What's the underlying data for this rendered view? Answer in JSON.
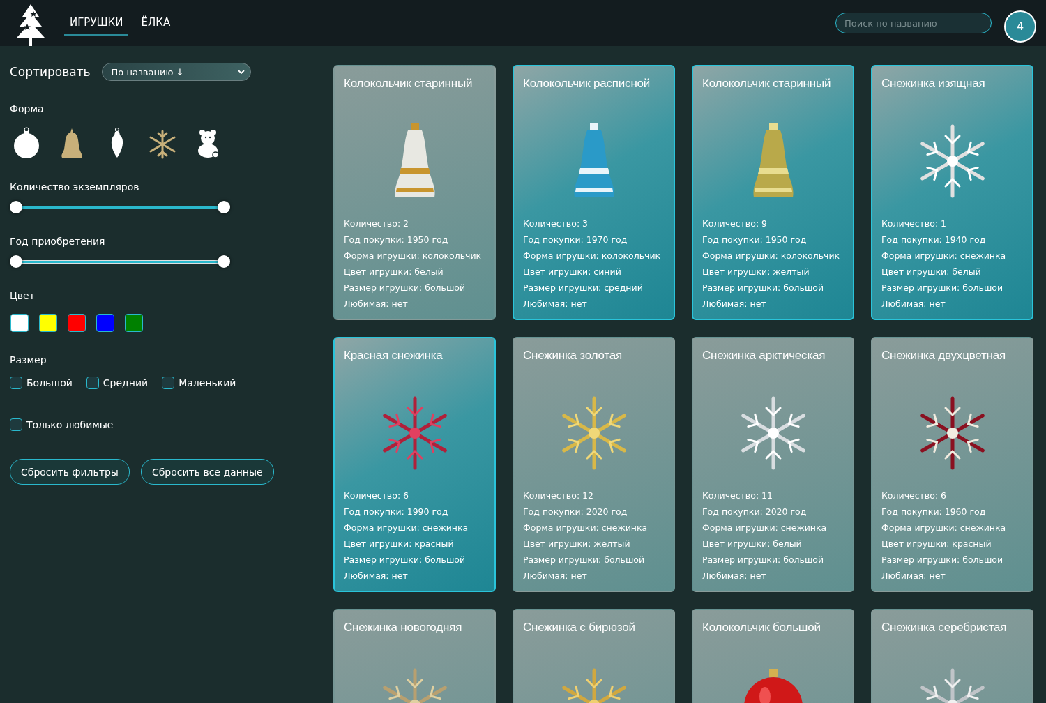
{
  "nav": {
    "tabs": [
      {
        "label": "ИГРУШКИ",
        "selected": true
      },
      {
        "label": "ЁЛКА",
        "selected": false
      }
    ]
  },
  "search": {
    "placeholder": "Поиск по названию"
  },
  "favorites_count": "4",
  "filters": {
    "sort": {
      "label": "Сортировать",
      "value": "По названию ↓"
    },
    "shape": {
      "label": "Форма"
    },
    "count": {
      "label": "Количество экземпляров",
      "thumbs": [
        {
          "level": 0
        },
        {
          "level": 1
        }
      ]
    },
    "year": {
      "label": "Год приобретения",
      "thumbs": [
        {
          "level": 0
        },
        {
          "level": 1
        }
      ]
    },
    "color": {
      "label": "Цвет",
      "swatches": [
        {
          "color": "#ffffff"
        },
        {
          "color": "#ffff00"
        },
        {
          "color": "#ff0000"
        },
        {
          "color": "#0000ff"
        },
        {
          "color": "#008000"
        }
      ]
    },
    "size": {
      "label": "Размер",
      "options": [
        {
          "label": "Большой",
          "checked": false
        },
        {
          "label": "Средний",
          "checked": false
        },
        {
          "label": "Маленький",
          "checked": false
        }
      ]
    },
    "favorites_only": {
      "label": "Только любимые",
      "checked": false
    },
    "buttons": [
      "Сбросить фильтры",
      "Сбросить все данные"
    ]
  },
  "cards": [
    {
      "title": "Колокольчик старинный",
      "selected": false,
      "details": [
        "Количество: 2",
        "Год покупки: 1950 год",
        "Форма игрушки: колокольчик",
        "Цвет игрушки: белый",
        "Размер игрушки: большой",
        "Любимая: нет"
      ]
    },
    {
      "title": "Колокольчик расписной",
      "selected": true,
      "details": [
        "Количество: 3",
        "Год покупки: 1970 год",
        "Форма игрушки: колокольчик",
        "Цвет игрушки: синий",
        "Размер игрушки: средний",
        "Любимая: нет"
      ]
    },
    {
      "title": "Колокольчик старинный",
      "selected": true,
      "details": [
        "Количество: 9",
        "Год покупки: 1950 год",
        "Форма игрушки: колокольчик",
        "Цвет игрушки: желтый",
        "Размер игрушки: большой",
        "Любимая: нет"
      ]
    },
    {
      "title": "Снежинка изящная",
      "selected": true,
      "details": [
        "Количество: 1",
        "Год покупки: 1940 год",
        "Форма игрушки: снежинка",
        "Цвет игрушки: белый",
        "Размер игрушки: большой",
        "Любимая: нет"
      ]
    },
    {
      "title": "Красная снежинка",
      "selected": true,
      "details": [
        "Количество: 6",
        "Год покупки: 1990 год",
        "Форма игрушки: снежинка",
        "Цвет игрушки: красный",
        "Размер игрушки: большой",
        "Любимая: нет"
      ]
    },
    {
      "title": "Снежинка золотая",
      "selected": false,
      "details": [
        "Количество: 12",
        "Год покупки: 2020 год",
        "Форма игрушки: снежинка",
        "Цвет игрушки: желтый",
        "Размер игрушки: большой",
        "Любимая: нет"
      ]
    },
    {
      "title": "Снежинка арктическая",
      "selected": false,
      "details": [
        "Количество: 11",
        "Год покупки: 2020 год",
        "Форма игрушки: снежинка",
        "Цвет игрушки: белый",
        "Размер игрушки: большой",
        "Любимая: нет"
      ]
    },
    {
      "title": "Снежинка двухцветная",
      "selected": false,
      "details": [
        "Количество: 6",
        "Год покупки: 1960 год",
        "Форма игрушки: снежинка",
        "Цвет игрушки: красный",
        "Размер игрушки: большой",
        "Любимая: нет"
      ]
    },
    {
      "title": "Снежинка новогодняя",
      "selected": false
    },
    {
      "title": "Снежинка с бирюзой",
      "selected": false
    },
    {
      "title": "Колокольчик большой",
      "selected": false
    },
    {
      "title": "Снежинка серебристая",
      "selected": false
    }
  ]
}
